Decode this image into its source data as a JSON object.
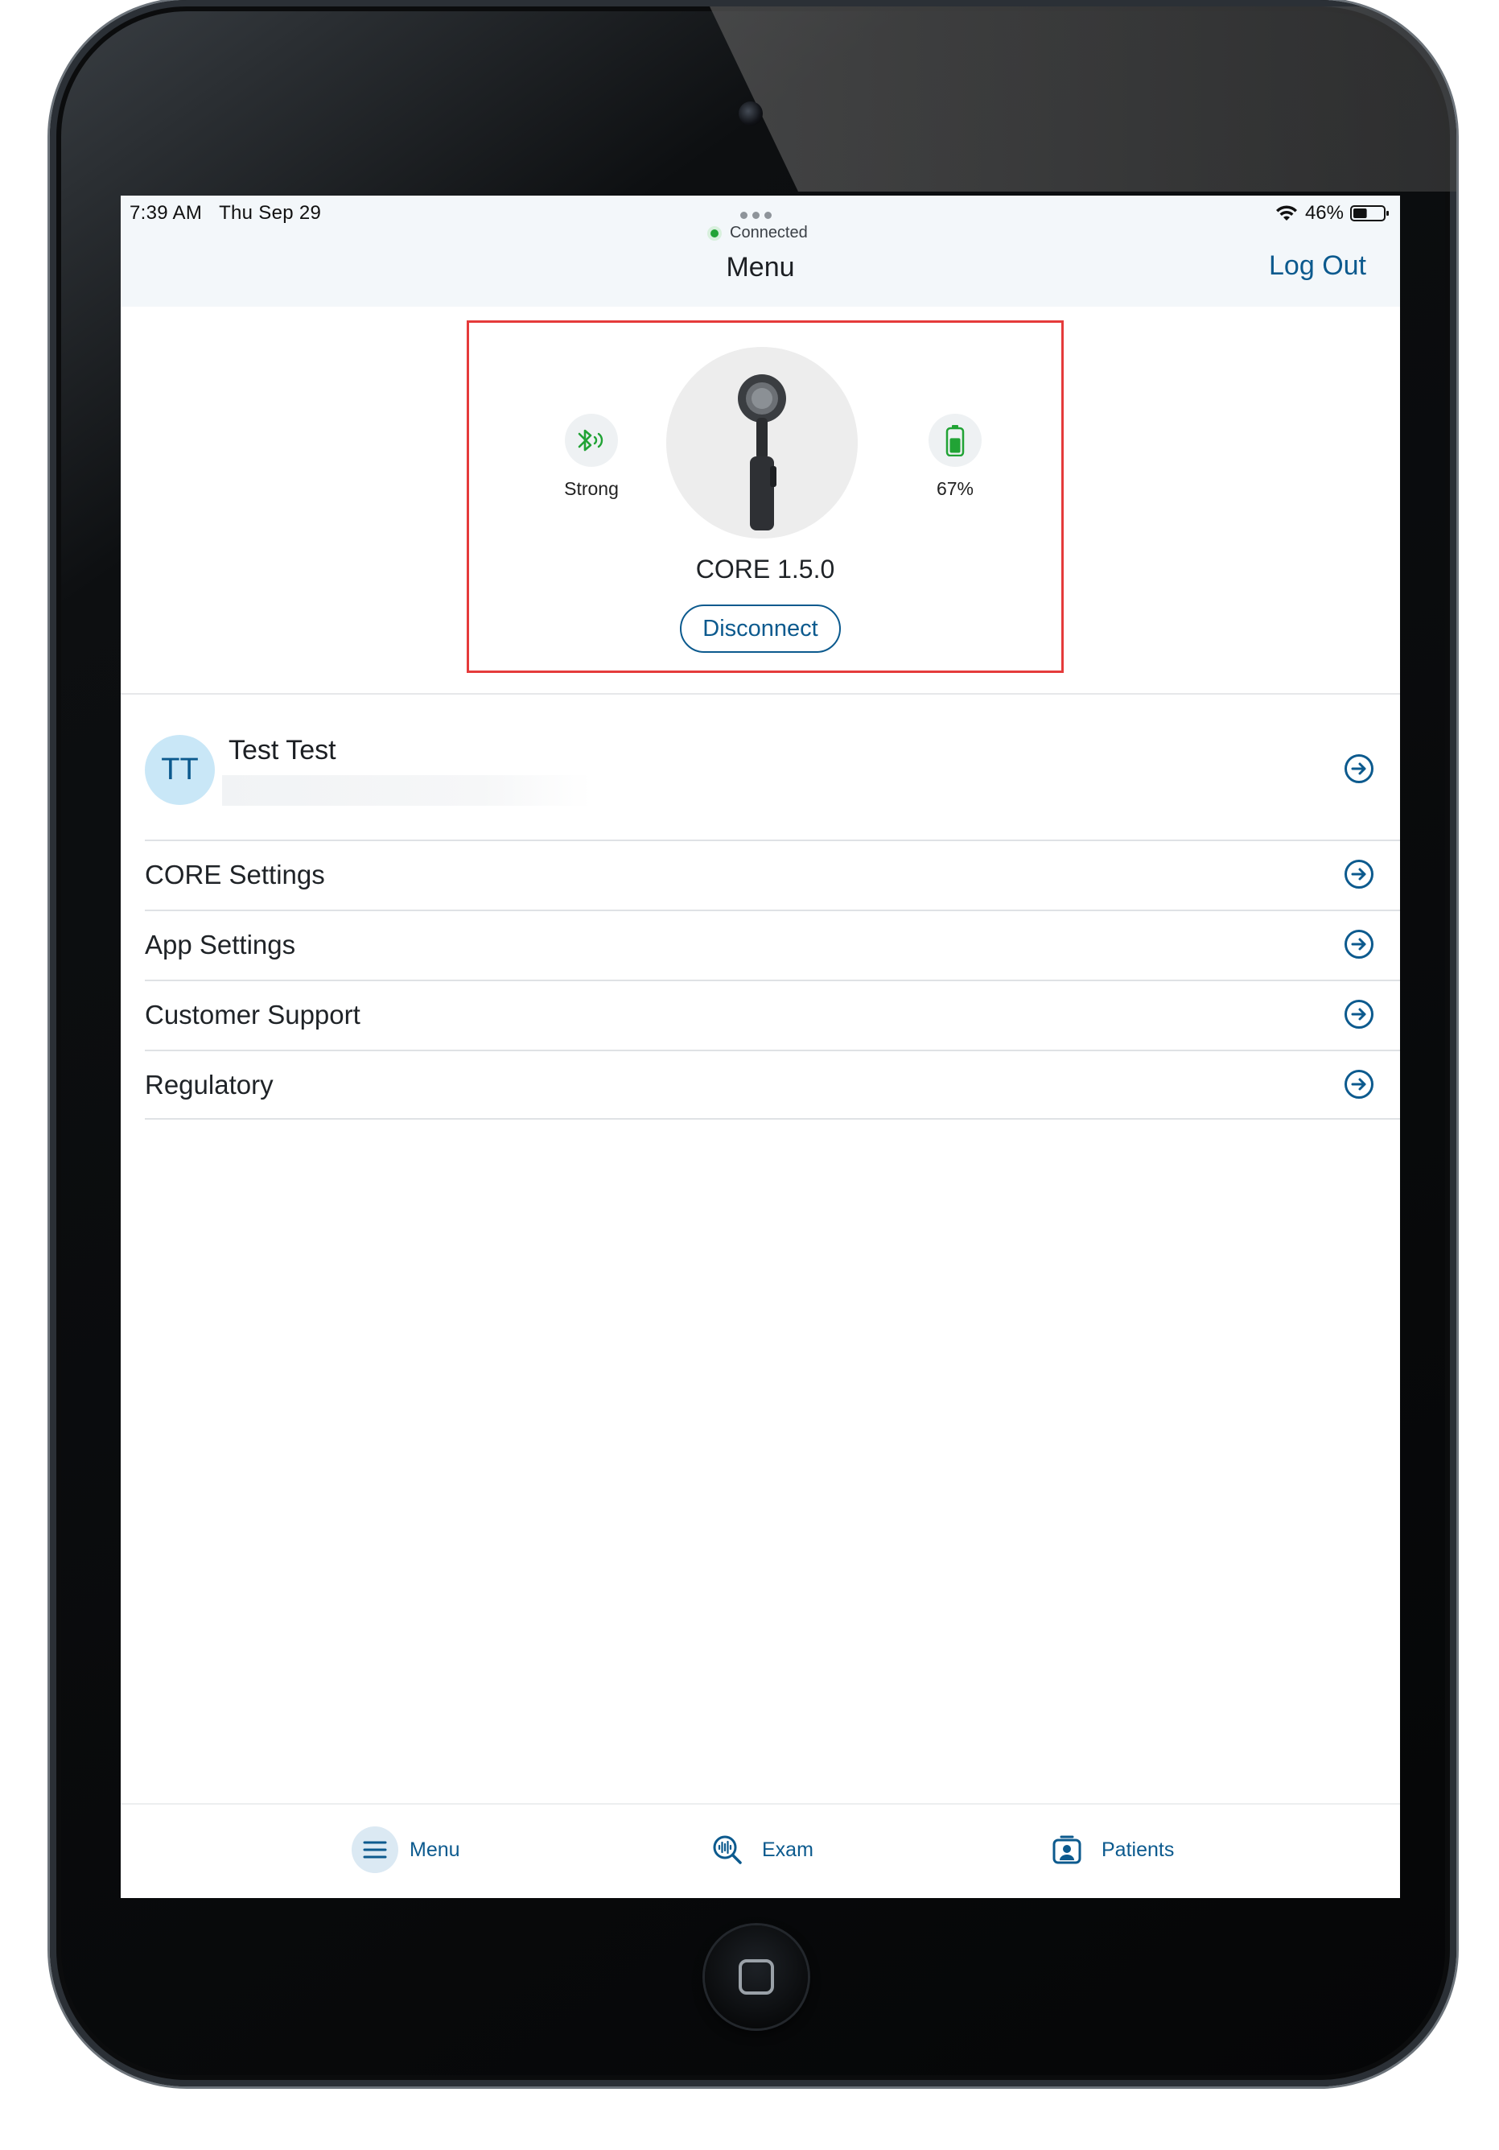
{
  "status_bar": {
    "time": "7:39 AM",
    "date": "Thu Sep 29",
    "battery_percent": "46%",
    "battery_level": 0.46,
    "icons": [
      "wifi-icon",
      "battery-icon"
    ]
  },
  "header": {
    "connection_status": "Connected",
    "title": "Menu",
    "logout_label": "Log Out"
  },
  "device_card": {
    "signal_label": "Strong",
    "signal_icon": "bluetooth-signal-icon",
    "battery_label": "67%",
    "battery_level": 0.67,
    "battery_icon": "battery-icon",
    "device_name": "CORE 1.5.0",
    "disconnect_label": "Disconnect"
  },
  "profile": {
    "initials": "TT",
    "name": "Test Test"
  },
  "menu": {
    "items": [
      {
        "label": "CORE Settings"
      },
      {
        "label": "App Settings"
      },
      {
        "label": "Customer Support"
      },
      {
        "label": "Regulatory"
      }
    ]
  },
  "tabs": {
    "menu": "Menu",
    "exam": "Exam",
    "patients": "Patients"
  },
  "colors": {
    "brand_blue": "#0c5a8e",
    "connected_green": "#21a335",
    "highlight_red": "#e53b3b"
  }
}
